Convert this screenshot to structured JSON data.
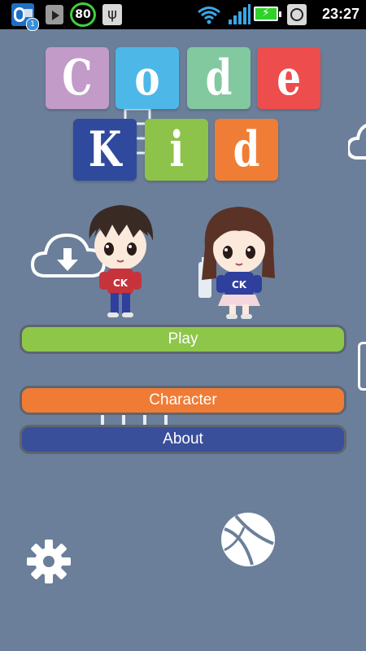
{
  "status_bar": {
    "notification_badge": "1",
    "battery_percent_indicator": "80",
    "time": "23:27",
    "icons": [
      "outlook-icon",
      "play-store-icon",
      "battery-circle-icon",
      "usb-icon",
      "wifi-icon",
      "signal-icon",
      "battery-icon",
      "alarm-icon"
    ]
  },
  "logo": {
    "row1": [
      "C",
      "o",
      "d",
      "e"
    ],
    "row2": [
      "K",
      "i",
      "d"
    ],
    "colors": [
      "#c29bc8",
      "#4db8e8",
      "#82c9a0",
      "#ee4d4d",
      "#2f4a9c",
      "#8dc34a",
      "#f07d35"
    ]
  },
  "characters": [
    {
      "badge": "CK",
      "shirt_color": "#c7333b"
    },
    {
      "badge": "CK",
      "shirt_color": "#2e3f9e"
    }
  ],
  "menu": {
    "play_label": "Play",
    "character_label": "Character",
    "about_label": "About"
  },
  "colors": {
    "background": "#6b7f9a",
    "play": "#8ec64a",
    "character": "#f07b35",
    "about": "#3a4f9a"
  }
}
